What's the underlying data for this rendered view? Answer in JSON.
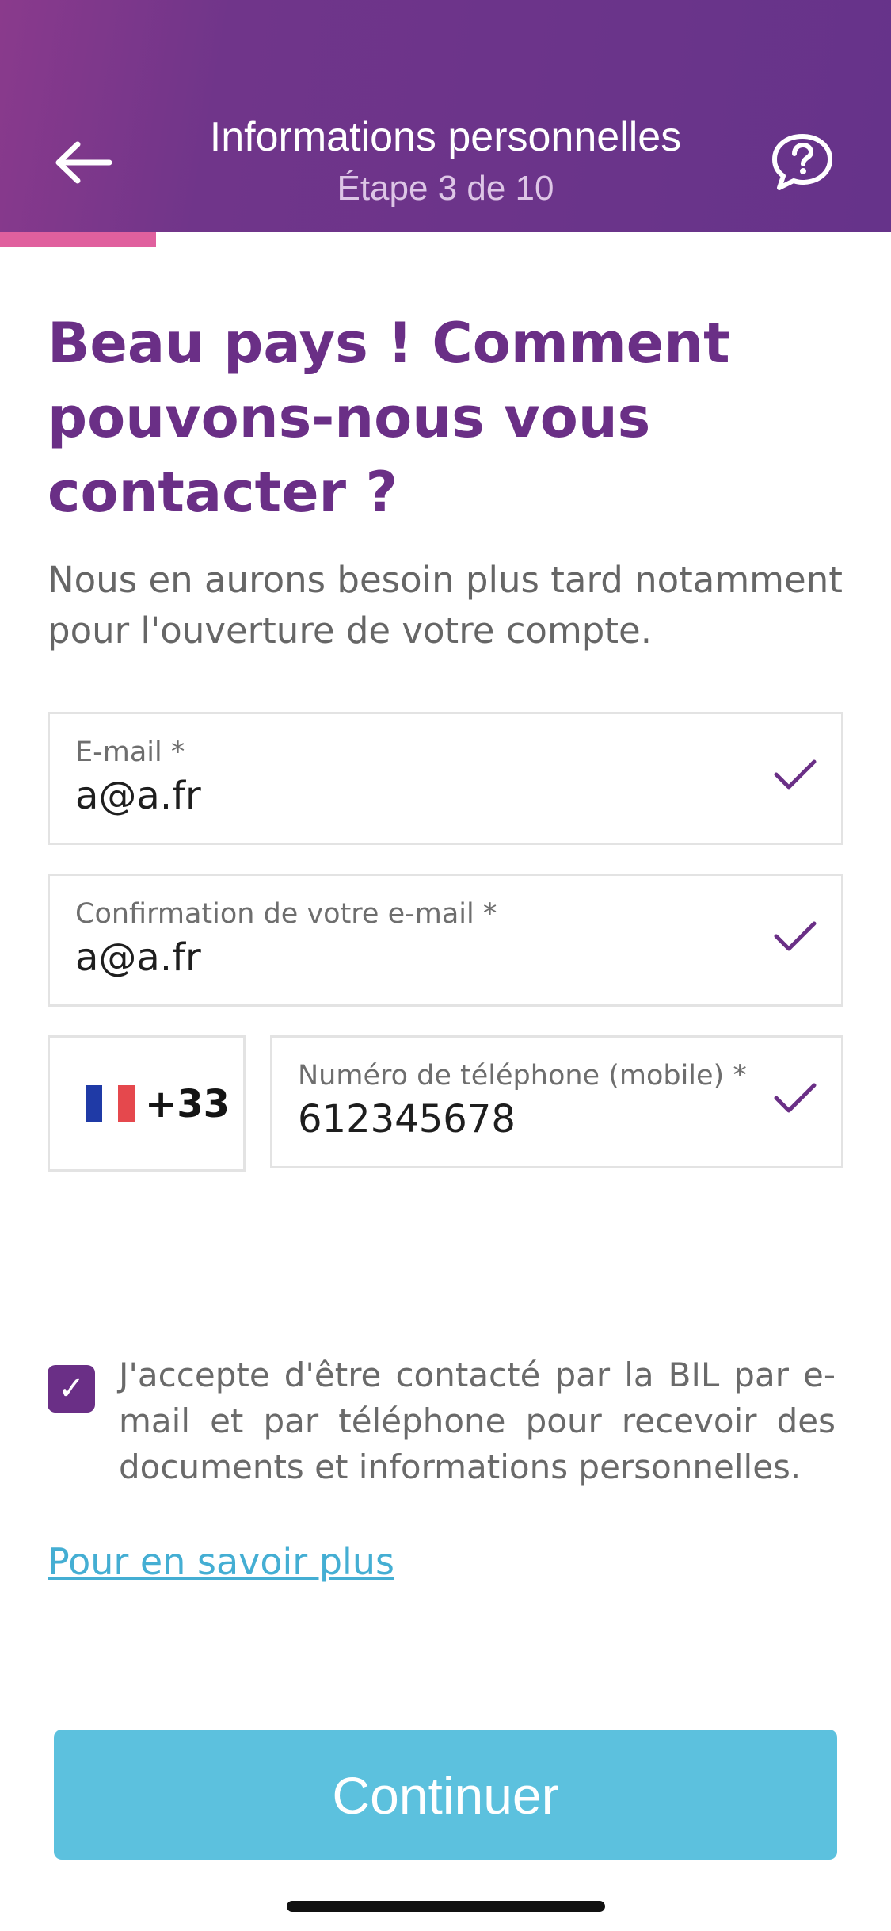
{
  "header": {
    "title": "Informations personnelles",
    "step": "Étape 3 de 10",
    "progress_fraction": 0.3
  },
  "main": {
    "headline": "Beau pays ! Comment pouvons-nous vous contacter ?",
    "subtext": "Nous en aurons besoin plus tard notamment pour l'ouverture de votre compte."
  },
  "form": {
    "email": {
      "label": "E-mail *",
      "value": "a@a.fr"
    },
    "email_confirm": {
      "label": "Confirmation de votre e-mail *",
      "value": "a@a.fr"
    },
    "phone": {
      "country_code": "+33",
      "country_flag": "france-flag-icon",
      "label": "Numéro de téléphone (mobile) *",
      "value": "612345678"
    }
  },
  "consent": {
    "checked": true,
    "check_glyph": "✓",
    "text": "J'accepte d'être contacté par la BIL par e-mail et par téléphone pour recevoir des documents et informations personnelles."
  },
  "links": {
    "learn_more": "Pour en savoir plus"
  },
  "actions": {
    "continue_label": "Continuer"
  },
  "colors": {
    "brand_purple": "#6a2f86",
    "progress_pink": "#e0609e",
    "button_blue": "#5cc1de",
    "link_blue": "#44aed3"
  }
}
